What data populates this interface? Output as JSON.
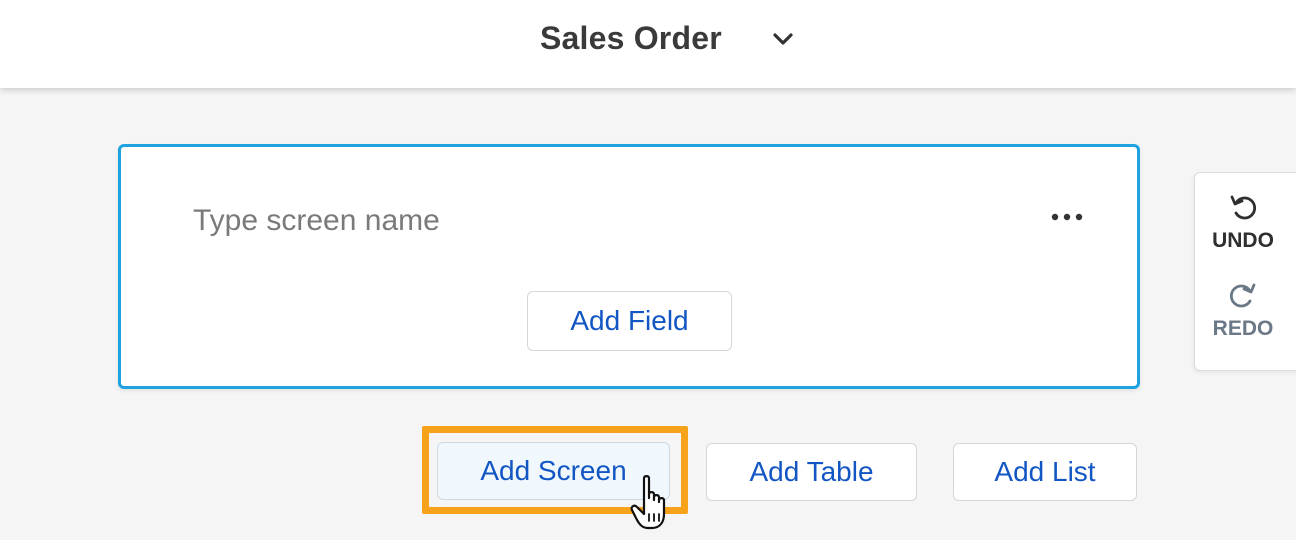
{
  "header": {
    "title": "Sales Order",
    "dropdown_icon": "chevron-down-icon"
  },
  "screen_card": {
    "name_value": "",
    "name_placeholder": "Type screen name",
    "more_icon": "more-horizontal-icon",
    "add_field_label": "Add Field",
    "border_color": "#1fa3e0"
  },
  "history": {
    "undo_label": "UNDO",
    "undo_icon": "undo-icon",
    "redo_label": "REDO",
    "redo_icon": "redo-icon"
  },
  "actions": {
    "add_screen_label": "Add Screen",
    "add_table_label": "Add Table",
    "add_list_label": "Add List",
    "highlight_color": "#f7a21b",
    "link_color": "#1256c4"
  },
  "cursor_icon": "hand-pointer-icon"
}
